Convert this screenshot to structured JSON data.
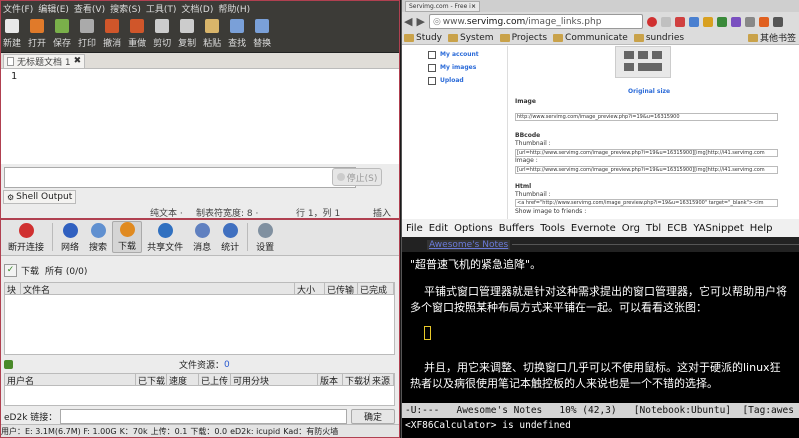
{
  "gedit": {
    "menu": [
      "文件(F)",
      "编辑(E)",
      "查看(V)",
      "搜索(S)",
      "工具(T)",
      "文档(D)",
      "帮助(H)"
    ],
    "toolbar": [
      {
        "label": "新建",
        "icon": "new-document-icon",
        "color": "#e8e8e8"
      },
      {
        "label": "打开",
        "icon": "open-folder-icon",
        "color": "#e07a2a"
      },
      {
        "label": "保存",
        "icon": "save-icon",
        "color": "#7ab04a"
      },
      {
        "label": "打印",
        "icon": "print-icon",
        "color": "#aaaaaa"
      },
      {
        "label": "撤消",
        "icon": "undo-icon",
        "color": "#d0562a"
      },
      {
        "label": "重做",
        "icon": "redo-icon",
        "color": "#d0562a"
      },
      {
        "label": "剪切",
        "icon": "cut-icon",
        "color": "#cccccc"
      },
      {
        "label": "复制",
        "icon": "copy-icon",
        "color": "#cccccc"
      },
      {
        "label": "粘贴",
        "icon": "paste-icon",
        "color": "#d9b56a"
      },
      {
        "label": "查找",
        "icon": "find-icon",
        "color": "#7aa0d8"
      },
      {
        "label": "替换",
        "icon": "replace-icon",
        "color": "#7aa0d8"
      }
    ],
    "tab_title": "无标题文档 1",
    "line_number": "1",
    "stop_label": "停止(S)",
    "shell_tab": "Shell Output",
    "status": {
      "mode": "纯文本 ·",
      "tabwidth": "制表符宽度: 8 ·",
      "position": "行 1，列 1",
      "insert": "插入"
    }
  },
  "firefox": {
    "tab_title": "Servimg.com - Free image",
    "url_prefix": "www.",
    "url_domain": "servimg.com",
    "url_path": "/image_links.php",
    "bookmarks": [
      "Study",
      "System",
      "Projects",
      "Communicate",
      "sundries"
    ],
    "other_bookmarks": "其他书签",
    "side_links": [
      "My account",
      "My images",
      "Upload"
    ],
    "original_size": "Original size",
    "image_section": "Image",
    "image_url": "http://www.servimg.com/image_preview.php?i=19&u=16315900",
    "bbcode_section": "BBcode",
    "thumbnail_label": "Thumbnail :",
    "bbcode_thumb": "[url=http://www.servimg.com/image_preview.php?i=19&u=16315900][img]http://i41.servimg.com",
    "image_label": "Image :",
    "bbcode_image": "[url=http://www.servimg.com/image_preview.php?i=19&u=16315900][img]http://i41.servimg.com",
    "html_section": "Html",
    "html_thumb": "<a href=\"http://www.servimg.com/image_preview.php?i=19&u=16315900\" target=\"_blank\"><im",
    "show_friends": "Show image to friends :"
  },
  "amule": {
    "toolbar": [
      {
        "label": "断开连接",
        "icon": "disconnect-icon",
        "color": "#d03030"
      },
      {
        "label": "网络",
        "icon": "network-icon",
        "color": "#3060c0"
      },
      {
        "label": "搜索",
        "icon": "search-icon",
        "color": "#6090d0"
      },
      {
        "label": "下载",
        "icon": "download-icon",
        "color": "#e08a20"
      },
      {
        "label": "共享文件",
        "icon": "shared-files-icon",
        "color": "#3070c0"
      },
      {
        "label": "消息",
        "icon": "messages-icon",
        "color": "#6080c0"
      },
      {
        "label": "统计",
        "icon": "statistics-icon",
        "color": "#4070c0"
      },
      {
        "label": "设置",
        "icon": "settings-icon",
        "color": "#8090a0"
      }
    ],
    "download_label": "下载",
    "all_label": "所有 (0/0)",
    "columns": [
      "块",
      "文件名",
      "大小",
      "已传输",
      "已完成"
    ],
    "source_label": "文件资源：",
    "source_count": "0",
    "src_columns": [
      "用户名",
      "已下载",
      "速度",
      "已上传",
      "可用分块",
      "版本",
      "下载状态",
      "来源"
    ],
    "ed2k_label": "eD2k 链接：",
    "confirm": "确定",
    "status": [
      "用户：E: 3.1M(6.7M) F: 1.00G",
      "K：70k",
      "上传：0.1",
      "下载：0.0",
      "eD2k: icupid",
      "Kad：有防火墙"
    ]
  },
  "emacs": {
    "menu": [
      "File",
      "Edit",
      "Options",
      "Buffers",
      "Tools",
      "Evernote",
      "Org",
      "Tbl",
      "ECB",
      "YASnippet",
      "Help"
    ],
    "buffer_title": "Awesome's Notes",
    "lines": [
      "\"超普速飞机的紧急追降\"。",
      "平铺式窗口管理器就是针对这种需求提出的窗口管理器，它可以帮助用户将",
      "多个窗口按照某种布局方式来平铺在一起。可以看看这张图：",
      "并且，用它来调整、切换窗口几乎可以不使用鼠标。这对于硬派的linux狂",
      "热者以及病很使用笔记本触控板的人来说也是一个不错的选择。"
    ],
    "modeline": "-U:---   Awesome's Notes   10% (42,3)   [Notebook:Ubuntu]  [Tag:awes",
    "minibuffer": "<XF86Calculator> is undefined"
  }
}
